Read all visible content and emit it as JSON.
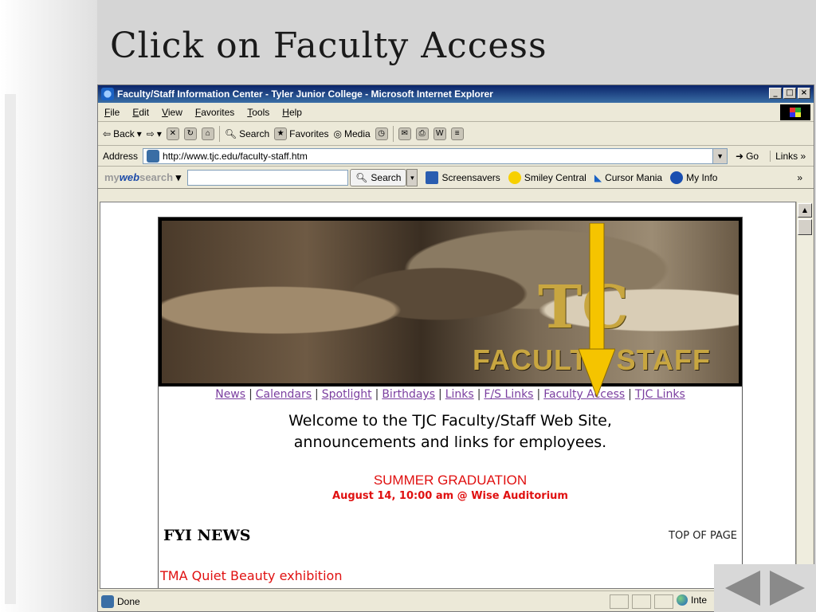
{
  "slide": {
    "title": "Click on Faculty Access"
  },
  "window": {
    "title": "Faculty/Staff Information Center - Tyler Junior College - Microsoft Internet Explorer",
    "minimize": "_",
    "maximize": "□",
    "close": "×"
  },
  "menu": [
    "File",
    "Edit",
    "View",
    "Favorites",
    "Tools",
    "Help"
  ],
  "toolbar": {
    "back": "Back",
    "search": "Search",
    "favorites": "Favorites",
    "media": "Media"
  },
  "address": {
    "label": "Address",
    "url": "http://www.tjc.edu/faculty-staff.htm",
    "go": "Go",
    "links": "Links"
  },
  "search_bar": {
    "logo_my": "my",
    "logo_web": "web",
    "logo_search": "search",
    "button": "Search",
    "links": [
      "Screensavers",
      "Smiley Central",
      "Cursor Mania",
      "My Info"
    ]
  },
  "page": {
    "banner_text": "FACULTY STAFF",
    "nav_links": [
      "News",
      "Calendars",
      "Spotlight",
      "Birthdays",
      "Links",
      "F/S Links",
      "Faculty Access",
      "TJC Links"
    ],
    "welcome_line1": "Welcome to the TJC Faculty/Staff Web Site,",
    "welcome_line2": "announcements and links for employees.",
    "graduation_title": "SUMMER GRADUATION",
    "graduation_date": "August 14, 10:00 am @ Wise Auditorium",
    "fyi_heading": "FYI NEWS",
    "top_of_page": "TOP OF PAGE",
    "news_item": "TMA Quiet Beauty exhibition"
  },
  "status": {
    "text": "Done",
    "zone": "Inte"
  },
  "colors": {
    "link": "#7b3fa0",
    "highlight_red": "#e01010",
    "arrow": "#f5c400",
    "title_bar": "#0a246a"
  }
}
